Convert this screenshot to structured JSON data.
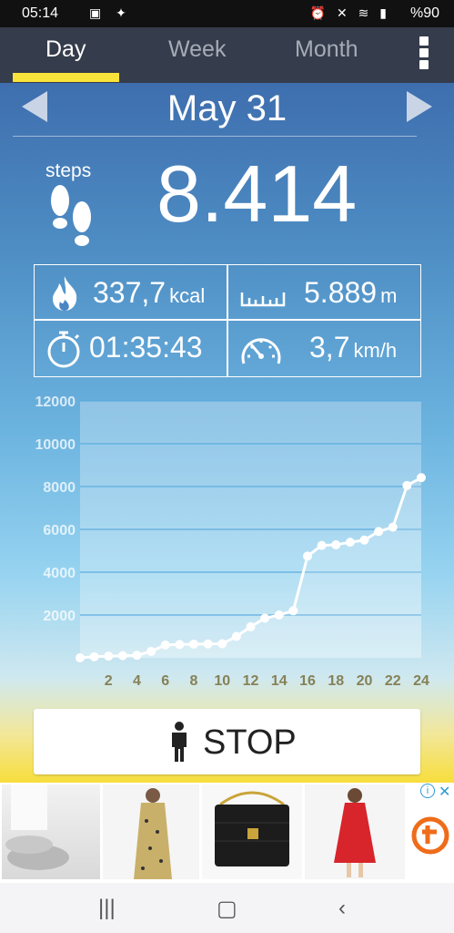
{
  "status": {
    "time": "05:14",
    "battery": "%90"
  },
  "tabs": [
    {
      "label": "Day",
      "active": true
    },
    {
      "label": "Week",
      "active": false
    },
    {
      "label": "Month",
      "active": false
    }
  ],
  "date": "May 31",
  "steps": {
    "label": "steps",
    "value": "8.414"
  },
  "stats": {
    "calories": {
      "value": "337,7",
      "unit": "kcal"
    },
    "distance": {
      "value": "5.889",
      "unit": "m"
    },
    "duration": {
      "value": "01:35:43"
    },
    "speed": {
      "value": "3,7",
      "unit": "km/h"
    }
  },
  "chart_data": {
    "type": "line",
    "x_tick_labels": [
      "2",
      "4",
      "6",
      "8",
      "10",
      "12",
      "14",
      "16",
      "18",
      "20",
      "22",
      "24"
    ],
    "y_tick_labels": [
      "2000",
      "4000",
      "6000",
      "8000",
      "10000",
      "12000"
    ],
    "ylim": [
      0,
      12000
    ],
    "xlim": [
      0,
      24
    ],
    "x": [
      0,
      1,
      2,
      3,
      4,
      5,
      6,
      7,
      8,
      9,
      10,
      11,
      12,
      13,
      14,
      15,
      16,
      17,
      18,
      19,
      20,
      21,
      22,
      23,
      24
    ],
    "values": [
      0,
      50,
      80,
      100,
      120,
      300,
      600,
      620,
      640,
      650,
      660,
      1000,
      1450,
      1850,
      2000,
      2200,
      4750,
      5250,
      5280,
      5400,
      5500,
      5900,
      6100,
      8050,
      8414
    ],
    "grid": true
  },
  "stop_button": {
    "label": "STOP"
  },
  "colors": {
    "tab_accent": "#f7e33a",
    "header": "#353c4b"
  }
}
